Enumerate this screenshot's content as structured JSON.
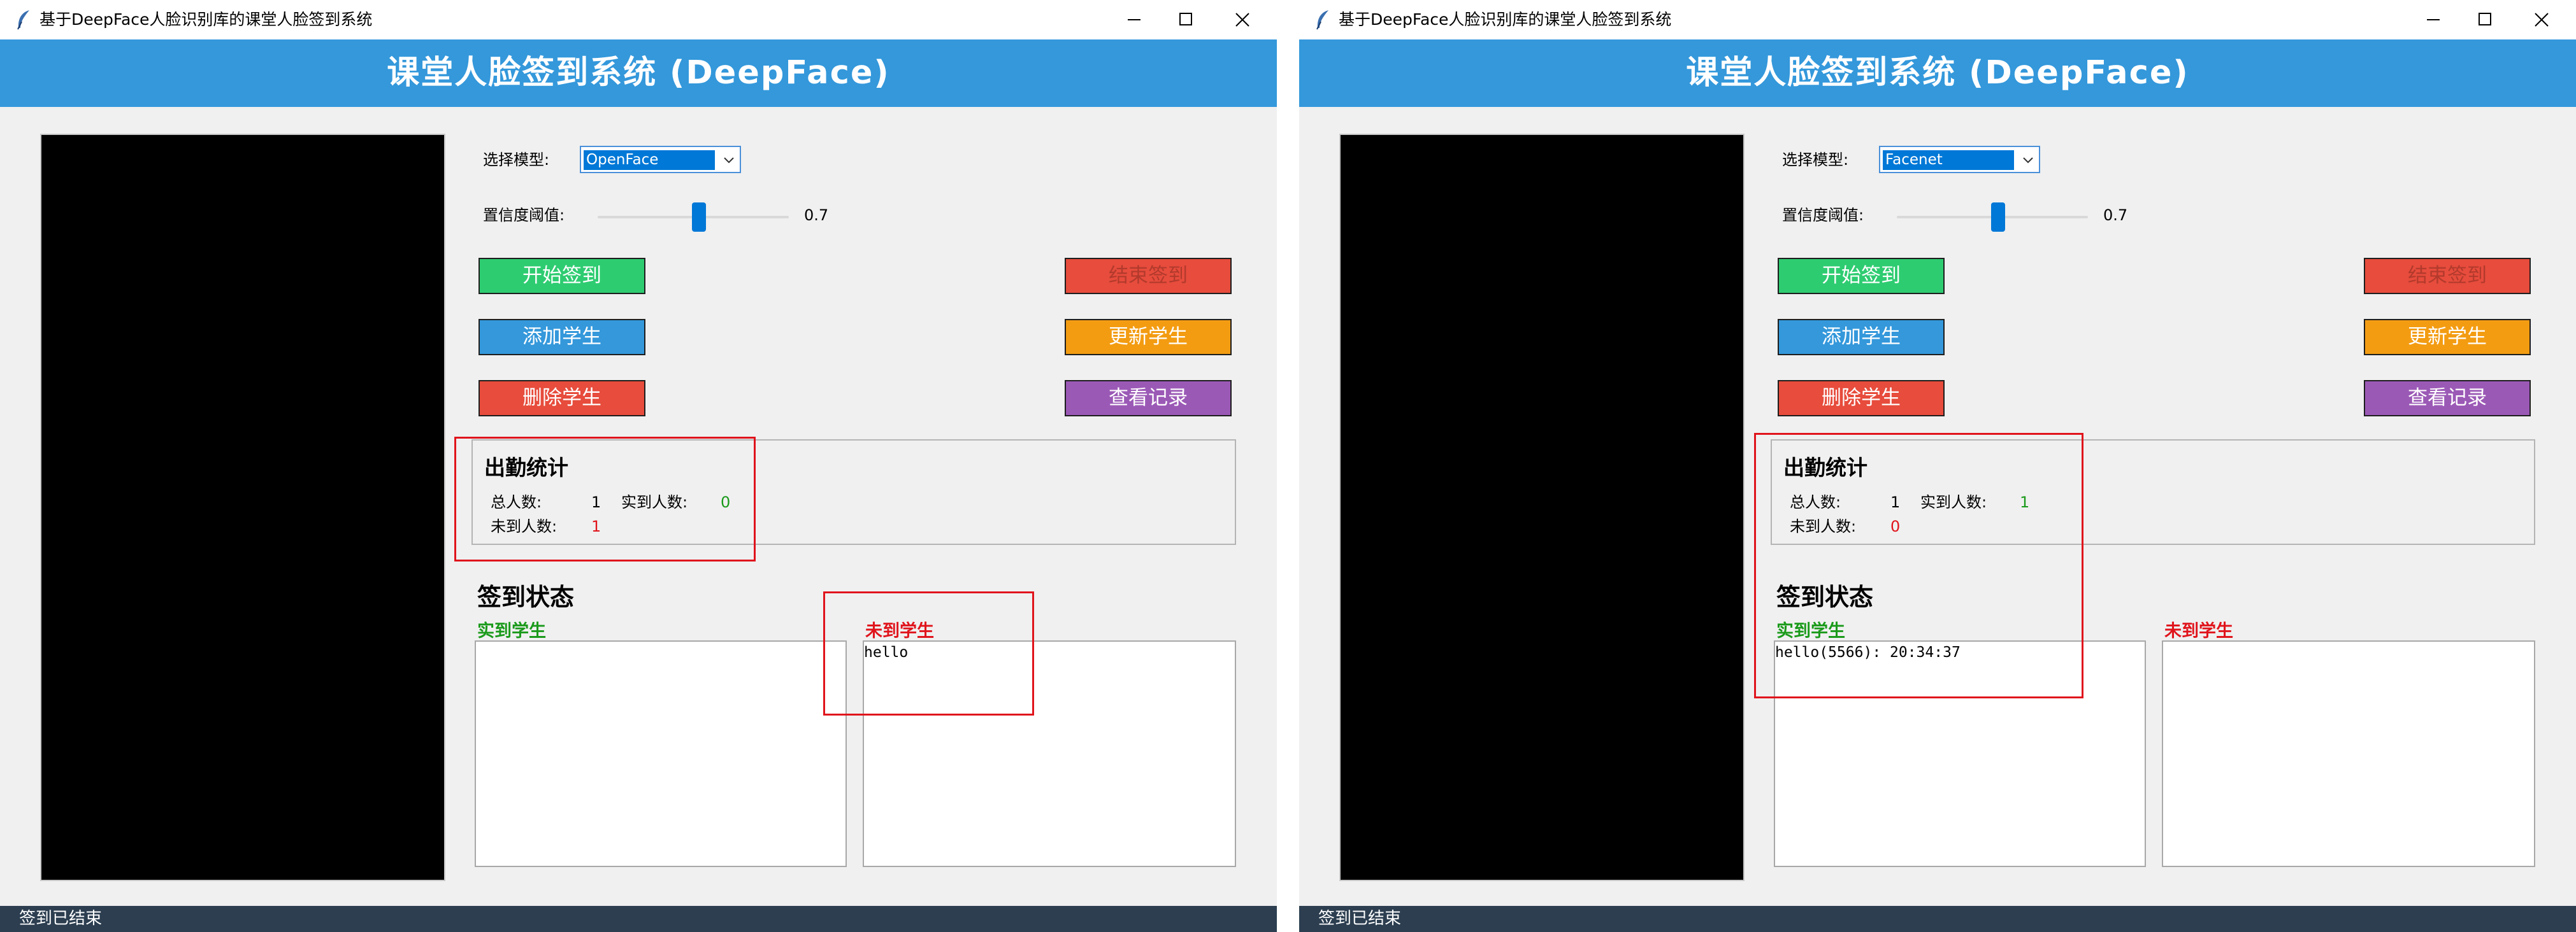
{
  "windows": [
    {
      "window_title": "基于DeepFace人脸识别库的课堂人脸签到系统",
      "header_title": "课堂人脸签到系统 (DeepFace)",
      "model_label": "选择模型:",
      "model_value": "OpenFace",
      "threshold_label": "置信度阈值:",
      "threshold_value": "0.7",
      "buttons": {
        "start": "开始签到",
        "stop": "结束签到",
        "add": "添加学生",
        "update": "更新学生",
        "delete": "删除学生",
        "records": "查看记录"
      },
      "stats": {
        "title": "出勤统计",
        "total_label": "总人数:",
        "total_value": "1",
        "present_label": "实到人数:",
        "present_value": "0",
        "absent_label": "未到人数:",
        "absent_value": "1"
      },
      "status_section_title": "签到状态",
      "present_list": {
        "label": "实到学生",
        "items": []
      },
      "absent_list": {
        "label": "未到学生",
        "items": [
          "hello"
        ]
      },
      "status_bar": "签到已结束"
    },
    {
      "window_title": "基于DeepFace人脸识别库的课堂人脸签到系统",
      "header_title": "课堂人脸签到系统 (DeepFace)",
      "model_label": "选择模型:",
      "model_value": "Facenet",
      "threshold_label": "置信度阈值:",
      "threshold_value": "0.7",
      "buttons": {
        "start": "开始签到",
        "stop": "结束签到",
        "add": "添加学生",
        "update": "更新学生",
        "delete": "删除学生",
        "records": "查看记录"
      },
      "stats": {
        "title": "出勤统计",
        "total_label": "总人数:",
        "total_value": "1",
        "present_label": "实到人数:",
        "present_value": "1",
        "absent_label": "未到人数:",
        "absent_value": "0"
      },
      "status_section_title": "签到状态",
      "present_list": {
        "label": "实到学生",
        "items": [
          "hello(5566): 20:34:37"
        ]
      },
      "absent_list": {
        "label": "未到学生",
        "items": []
      },
      "status_bar": "签到已结束"
    }
  ],
  "colors": {
    "header": "#3498db",
    "start_button": "#2ecc71",
    "add_button": "#3498db",
    "delete_button": "#e74c3c",
    "stop_button": "#e74c3c",
    "update_button": "#f39c12",
    "records_button": "#9b59b6",
    "present_color": "#1a9a1a",
    "absent_color": "#e0141c",
    "status_bar": "#2c3e50",
    "annotation_box": "#e0141c"
  },
  "icons": [
    "feather-icon",
    "minimize-icon",
    "maximize-icon",
    "close-icon",
    "chevron-down-icon"
  ]
}
